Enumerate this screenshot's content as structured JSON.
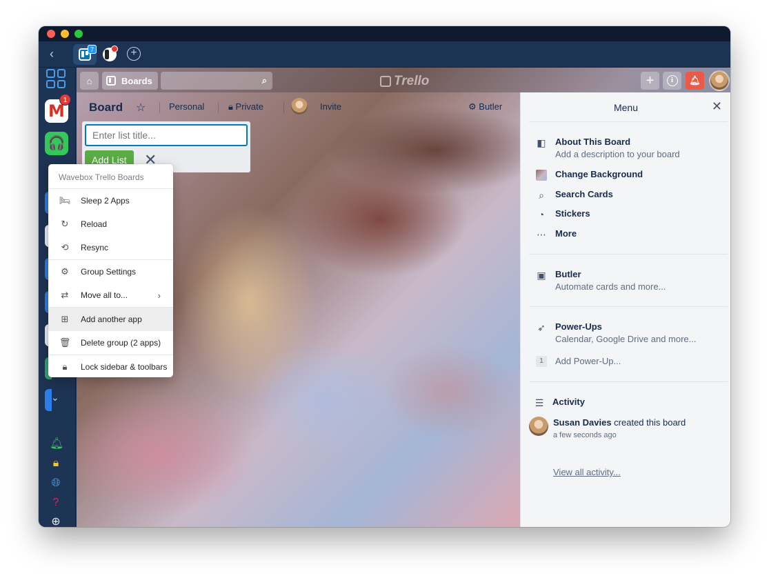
{
  "tabs": {
    "trello_badge": "7",
    "add_label": "+"
  },
  "sidebar": {
    "gmail_letter": "M",
    "gmail_badge": "1",
    "icons": [
      "grid-icon",
      "gmail-icon",
      "headset-icon",
      "chevron-down-icon",
      "bell-icon",
      "lock-icon",
      "globe-icon",
      "help-icon",
      "add-circle-icon",
      "gear-icon"
    ]
  },
  "trello": {
    "boards_label": "Boards",
    "logo_text": "Trello",
    "plus_label": "+",
    "info_label": "i"
  },
  "board_header": {
    "title": "Board",
    "star": "☆",
    "personal": "Personal",
    "private": "Private",
    "invite": "Invite",
    "butler": "Butler"
  },
  "add_list": {
    "placeholder": "Enter list title...",
    "button": "Add List",
    "close": "✕"
  },
  "context_menu": {
    "header": "Wavebox Trello Boards",
    "items": [
      {
        "label": "Sleep 2 Apps",
        "icon": "sleep-icon"
      },
      {
        "label": "Reload",
        "icon": "reload-icon"
      },
      {
        "label": "Resync",
        "icon": "resync-icon"
      },
      {
        "label": "Group Settings",
        "icon": "gear-icon"
      },
      {
        "label": "Move all to...",
        "icon": "swap-icon"
      },
      {
        "label": "Add another app",
        "icon": "add-app-icon"
      },
      {
        "label": "Delete group (2 apps)",
        "icon": "delete-icon"
      },
      {
        "label": "Lock sidebar & toolbars",
        "icon": "lock-icon"
      }
    ]
  },
  "menu": {
    "title": "Menu",
    "close": "✕",
    "about_title": "About This Board",
    "about_sub": "Add a description to your board",
    "change_bg": "Change Background",
    "search_cards": "Search Cards",
    "stickers": "Stickers",
    "more": "More",
    "butler_title": "Butler",
    "butler_sub": "Automate cards and more...",
    "powerups_title": "Power-Ups",
    "powerups_sub": "Calendar, Google Drive and more...",
    "powerup_count": "1",
    "add_powerup": "Add Power-Up...",
    "activity_title": "Activity",
    "activity_user": "Susan Davies",
    "activity_action": "created this board",
    "activity_time": "a few seconds ago",
    "view_all": "View all activity..."
  },
  "colors": {
    "window_bg": "#1e3454",
    "trello_blue": "#0079bf",
    "add_list_green": "#5aac44",
    "notification_red": "#eb5a46"
  }
}
